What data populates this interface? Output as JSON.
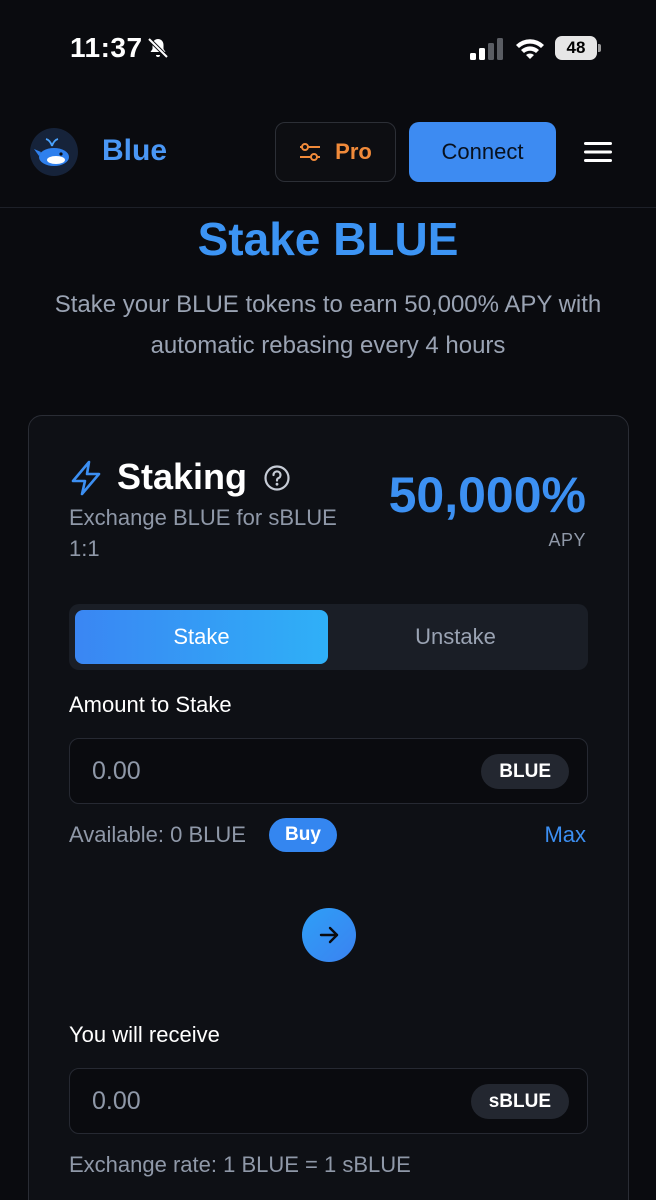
{
  "status_bar": {
    "time": "11:37",
    "battery": "48"
  },
  "header": {
    "brand": "Blue",
    "pro_label": "Pro",
    "connect_label": "Connect"
  },
  "hero": {
    "title": "Stake BLUE",
    "subtitle": "Stake your BLUE tokens to earn 50,000% APY with automatic rebasing every 4 hours"
  },
  "card": {
    "title": "Staking",
    "description": "Exchange BLUE for sBLUE 1:1",
    "apy_value": "50,000%",
    "apy_label": "APY",
    "tabs": [
      {
        "label": "Stake",
        "active": true
      },
      {
        "label": "Unstake",
        "active": false
      }
    ],
    "amount": {
      "label": "Amount to Stake",
      "placeholder": "0.00",
      "token": "BLUE"
    },
    "available": "Available: 0 BLUE",
    "buy_label": "Buy",
    "max_label": "Max",
    "receive": {
      "label": "You will receive",
      "placeholder": "0.00",
      "token": "sBLUE"
    },
    "exchange_rate": "Exchange rate: 1 BLUE = 1 sBLUE"
  },
  "colors": {
    "accent": "#3c94f4",
    "pro_orange": "#f08a3a",
    "background": "#0a0b0f",
    "card": "#0e1015"
  },
  "icons": {
    "bell": "bell-slash-icon",
    "signal": "cellular-signal-icon",
    "wifi": "wifi-icon",
    "pro": "sliders-icon",
    "menu": "hamburger-menu-icon",
    "bolt": "lightning-bolt-icon",
    "help": "question-circle-icon",
    "arrow": "arrow-right-icon",
    "logo": "whale-logo-icon"
  }
}
